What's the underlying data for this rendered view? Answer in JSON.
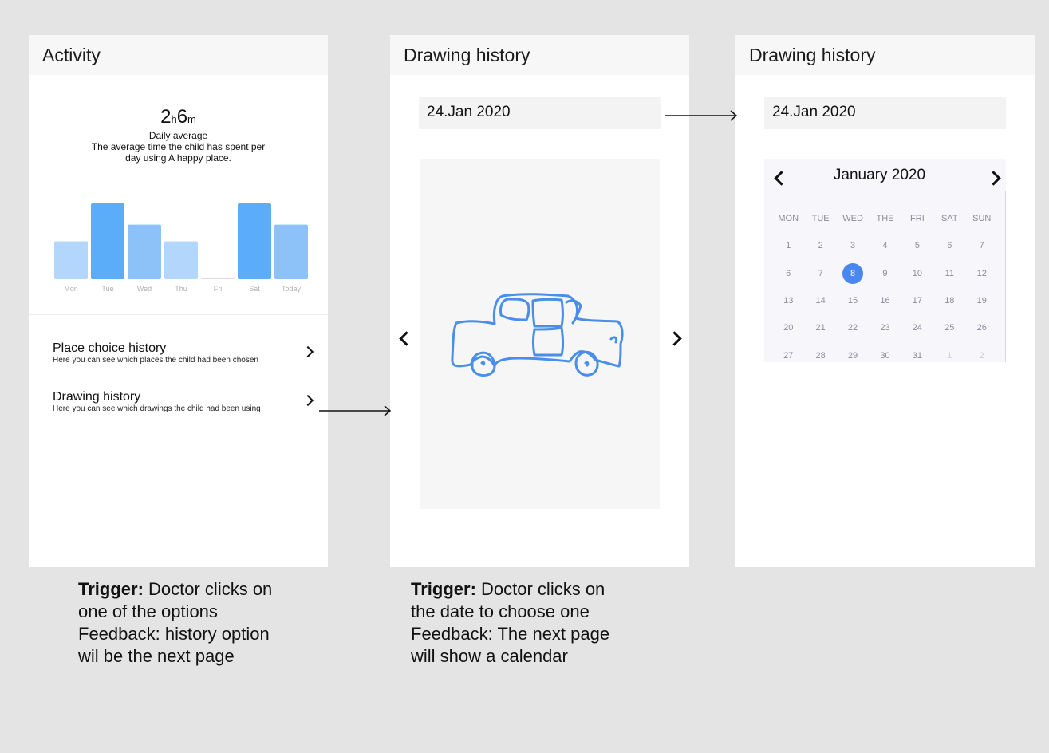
{
  "screens": {
    "activity": {
      "title": "Activity",
      "stat": {
        "hours": "2",
        "hours_unit": "h",
        "minutes": "6",
        "minutes_unit": "m",
        "label": "Daily average",
        "description": "The average time the child has spent per day using A happy place."
      },
      "menu": [
        {
          "title": "Place choice history",
          "description": "Here you can see which places the child had been chosen"
        },
        {
          "title": "Drawing history",
          "description": "Here you can see which drawings the child had been using"
        }
      ]
    },
    "drawing": {
      "title": "Drawing history",
      "date": "24.Jan  2020"
    },
    "calendar": {
      "title": "Drawing history",
      "date": "24.Jan  2020",
      "month_label": "January 2020",
      "weekdays": [
        "MON",
        "TUE",
        "WED",
        "THE",
        "FRI",
        "SAT",
        "SUN"
      ],
      "weeks": [
        [
          "1",
          "2",
          "3",
          "4",
          "5",
          "6",
          "7"
        ],
        [
          "6",
          "7",
          "8",
          "9",
          "10",
          "11",
          "12"
        ],
        [
          "13",
          "14",
          "15",
          "16",
          "17",
          "18",
          "19"
        ],
        [
          "20",
          "21",
          "22",
          "23",
          "24",
          "25",
          "26"
        ],
        [
          "27",
          "28",
          "29",
          "30",
          "31",
          "1",
          "2"
        ]
      ],
      "selected_day": "8",
      "colors": {
        "selected": "#4a86f0"
      }
    }
  },
  "chart_data": {
    "type": "bar",
    "categories": [
      "Mon",
      "Tue",
      "Wed",
      "Thu",
      "Fri",
      "Sat",
      "Today"
    ],
    "values": [
      0.5,
      1.0,
      0.72,
      0.5,
      0.02,
      1.0,
      0.72
    ],
    "colors": [
      "#b3d7fc",
      "#5badfa",
      "#8cc2f8",
      "#b3d7fc",
      "#d9d9d9",
      "#5badfa",
      "#8cc2f8"
    ],
    "grid": false
  },
  "captions": [
    {
      "bold": "Trigger:",
      "line1": " Doctor clicks on",
      "lines": [
        "one of the options",
        "Feedback: history option",
        "wil be the next page"
      ]
    },
    {
      "bold": "Trigger:",
      "line1": " Doctor clicks on",
      "lines": [
        "the date to choose one",
        "Feedback: The next page",
        "will show a calendar"
      ]
    }
  ]
}
